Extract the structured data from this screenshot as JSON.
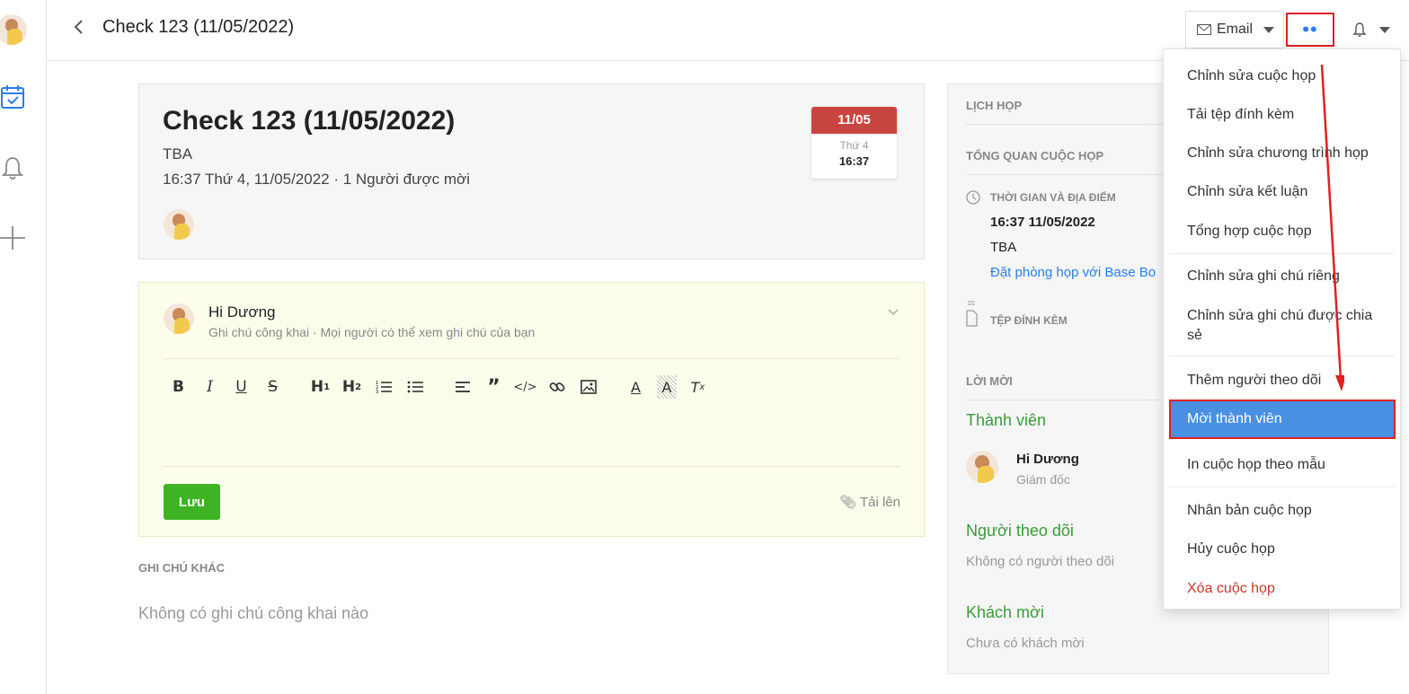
{
  "header": {
    "back_icon": "chevron-left-icon",
    "title": "Check 123 (11/05/2022)",
    "email_label": "Email",
    "more_label": "••",
    "bell_icon": "bell-icon"
  },
  "rail": {
    "items": [
      "calendar-check-icon",
      "bell-icon",
      "plus-icon"
    ]
  },
  "meeting": {
    "title": "Check 123 (11/05/2022)",
    "location": "TBA",
    "when": "16:37 Thứ 4, 11/05/2022 · 1 Người được mời",
    "date_badge": {
      "day": "11/05",
      "weekday": "Thứ 4",
      "time": "16:37"
    }
  },
  "note": {
    "author": "Hi Dương",
    "visibility": "Ghi chú công khai · Mọi người có thể xem ghi chú của bạn",
    "toolbar": [
      "B",
      "I",
      "U",
      "S",
      "H1",
      "H2",
      "ordered-list-icon",
      "bullet-list-icon",
      "align-icon",
      "quote-icon",
      "code-icon",
      "link-icon",
      "image-icon",
      "text-color-icon",
      "highlight-icon",
      "clear-format-icon"
    ],
    "save_label": "Lưu",
    "upload_label": "Tải lên"
  },
  "other_notes": {
    "heading": "GHI CHÚ KHÁC",
    "empty": "Không có ghi chú công khai nào"
  },
  "side": {
    "schedule_heading": "LỊCH HỌP",
    "overview_heading": "TỔNG QUAN CUỘC HỌP",
    "time_place_label": "THỜI GIAN VÀ ĐỊA ĐIỂM",
    "time_value": "16:37 11/05/2022",
    "place_value": "TBA",
    "book_room_link": "Đặt phòng họp với Base Bo",
    "attachments_label": "TỆP ĐÍNH KÈM",
    "invites_heading": "LỜI MỜI",
    "members_heading": "Thành viên",
    "member_name": "Hi Dương",
    "member_role": "Giám đốc",
    "followers_heading": "Người theo dõi",
    "followers_empty": "Không có người theo dõi",
    "guests_heading": "Khách mời",
    "guests_empty": "Chưa có khách mời"
  },
  "menu": {
    "items": [
      "Chỉnh sửa cuộc họp",
      "Tải tệp đính kèm",
      "Chỉnh sửa chương trình họp",
      "Chỉnh sửa kết luận",
      "Tổng hợp cuộc họp",
      "Chỉnh sửa ghi chú riêng",
      "Chỉnh sửa ghi chú được chia sẻ",
      "Thêm người theo dõi",
      "Mời thành viên",
      "In cuộc họp theo mẫu",
      "Nhân bản cuộc họp",
      "Hủy cuộc họp",
      "Xóa cuộc họp"
    ],
    "highlighted": "Mời thành viên",
    "annotation_color": "#e02020",
    "accent_color": "#4a90e2"
  }
}
